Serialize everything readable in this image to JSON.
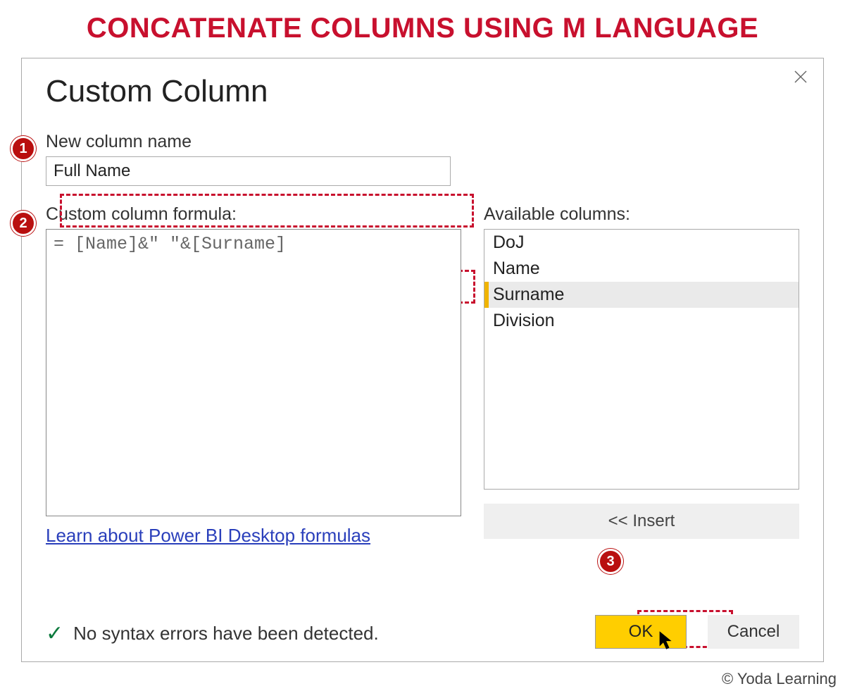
{
  "page_heading": "CONCATENATE COLUMNS USING M LANGUAGE",
  "dialog": {
    "title": "Custom Column",
    "new_col_label": "New column name",
    "new_col_value": "Full Name",
    "formula_label": "Custom column formula:",
    "formula_value": "= [Name]&\" \"&[Surname]",
    "available_label": "Available columns:",
    "available_columns": [
      "DoJ",
      "Name",
      "Surname",
      "Division"
    ],
    "selected_column_index": 2,
    "insert_label": "<< Insert",
    "learn_link": "Learn about Power BI Desktop formulas",
    "status_text": "No syntax errors have been detected.",
    "ok_label": "OK",
    "cancel_label": "Cancel"
  },
  "callouts": {
    "c1": "1",
    "c2": "2",
    "c3": "3"
  },
  "copyright": "© Yoda Learning"
}
